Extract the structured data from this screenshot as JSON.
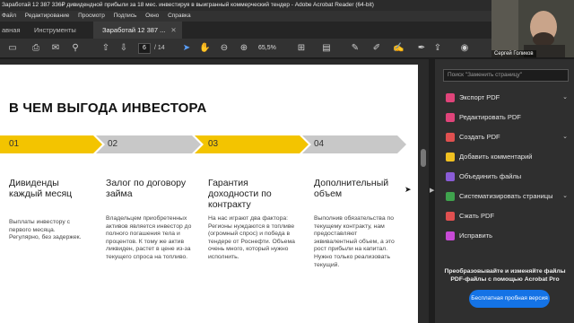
{
  "window": {
    "title": "Заработай 12 387 336₽ дивидендной прибыли за 18 мес. инвестируя в выигранный коммерческий тендер - Adobe Acrobat Reader (64-bit)"
  },
  "menu": [
    "Файл",
    "Редактирование",
    "Просмотр",
    "Подпись",
    "Окно",
    "Справка"
  ],
  "tabs": {
    "home": "авная",
    "tools": "Инструменты",
    "document": "Заработай 12 387 ..."
  },
  "toolbar": {
    "page_current": "6",
    "page_total": "/ 14",
    "zoom": "65,5%"
  },
  "slide": {
    "heading": "В ЧЕМ ВЫГОДА ИНВЕСТОРА",
    "steps": [
      {
        "num": "01",
        "title": "Дивиденды каждый месяц",
        "text": "Выплаты инвестору с первого месяца. Регулярно, без задержек."
      },
      {
        "num": "02",
        "title": "Залог по договору займа",
        "text": "Владельцем приобретенных активов является инвестор до полного погашения тела и процентов. К тому же актив ликвиден, растет в цене из-за текущего спроса на топливо."
      },
      {
        "num": "03",
        "title": "Гарантия доходности по контракту",
        "text": "На нас играют два фактора: Регионы нуждаются в топливе (огромный спрос) и победа в тендере от Роснефти. Объема очень много, который нужно исполнить."
      },
      {
        "num": "04",
        "title": "Дополнительный объем",
        "text": "Выполнив обязательства по текущему контракту, нам предоставляют эквивалентный объем, а это рост прибыли на капитал. Нужно только реализовать текущий."
      }
    ],
    "colors": {
      "active": "#f3c400",
      "inactive": "#c8c8c8"
    }
  },
  "right_panel": {
    "search_placeholder": "Поиск \"Заменить страницу\"",
    "items": [
      {
        "label": "Экспорт PDF",
        "icon": "export-pdf-icon",
        "color": "#e0447a",
        "expand": true
      },
      {
        "label": "Редактировать PDF",
        "icon": "edit-pdf-icon",
        "color": "#e0447a",
        "expand": false
      },
      {
        "label": "Создать PDF",
        "icon": "create-pdf-icon",
        "color": "#e05050",
        "expand": true
      },
      {
        "label": "Добавить комментарий",
        "icon": "comment-icon",
        "color": "#f0c020",
        "expand": false
      },
      {
        "label": "Объединить файлы",
        "icon": "combine-files-icon",
        "color": "#8a5cd6",
        "expand": false
      },
      {
        "label": "Систематизировать страницы",
        "icon": "organize-pages-icon",
        "color": "#3fa34d",
        "expand": true
      },
      {
        "label": "Сжать PDF",
        "icon": "compress-pdf-icon",
        "color": "#e05050",
        "expand": false
      },
      {
        "label": "Исправить",
        "icon": "fill-sign-icon",
        "color": "#c74ad6",
        "expand": false
      }
    ],
    "promo": "Преобразовывайте и изменяйте файлы PDF-файлы с помощью Acrobat Pro",
    "trial_button": "Бесплатная пробная версия"
  },
  "video": {
    "name": "Сергей Голиков"
  }
}
